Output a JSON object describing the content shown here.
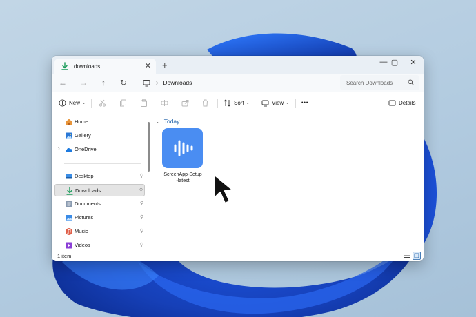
{
  "colors": {
    "accent": "#1c5fa8",
    "app_icon_bg": "#4a8df2",
    "download_arrow": "#1a9c5a",
    "selected_bg": "#e4e4e4"
  },
  "tab": {
    "title": "downloads",
    "icon": "download-icon",
    "close_label": "✕",
    "new_tab_label": "+"
  },
  "window_controls": {
    "minimize": "—",
    "maximize": "▢",
    "close": "✕"
  },
  "navigation": {
    "back": "←",
    "forward": "→",
    "up": "↑",
    "refresh": "↻"
  },
  "address": {
    "separator": "›",
    "crumbs": [
      "Downloads"
    ]
  },
  "search": {
    "placeholder": "Search Downloads"
  },
  "toolbar": {
    "new_label": "New",
    "sort_label": "Sort",
    "view_label": "View",
    "more_label": "•••",
    "details_label": "Details",
    "icons": [
      "cut-icon",
      "copy-icon",
      "paste-icon",
      "rename-icon",
      "share-icon",
      "delete-icon"
    ]
  },
  "sidebar": {
    "items": [
      {
        "label": "Home",
        "icon": "home-icon"
      },
      {
        "label": "Gallery",
        "icon": "gallery-icon"
      },
      {
        "label": "OneDrive",
        "icon": "onedrive-icon",
        "expander": "›"
      },
      {
        "label": "Desktop",
        "icon": "desktop-icon",
        "pin": "📌"
      },
      {
        "label": "Downloads",
        "icon": "download-icon",
        "pin": "📌",
        "selected": true
      },
      {
        "label": "Documents",
        "icon": "documents-icon",
        "pin": "📌"
      },
      {
        "label": "Pictures",
        "icon": "pictures-icon",
        "pin": "📌"
      },
      {
        "label": "Music",
        "icon": "music-icon",
        "pin": "📌"
      },
      {
        "label": "Videos",
        "icon": "videos-icon",
        "pin": "📌"
      }
    ]
  },
  "content": {
    "group_label": "Today",
    "group_chevron": "⌄",
    "files": [
      {
        "name_line1": "ScreenApp-Setup",
        "name_line2": "-latest",
        "icon": "screenapp-icon"
      }
    ]
  },
  "status": {
    "count": "1 item"
  }
}
